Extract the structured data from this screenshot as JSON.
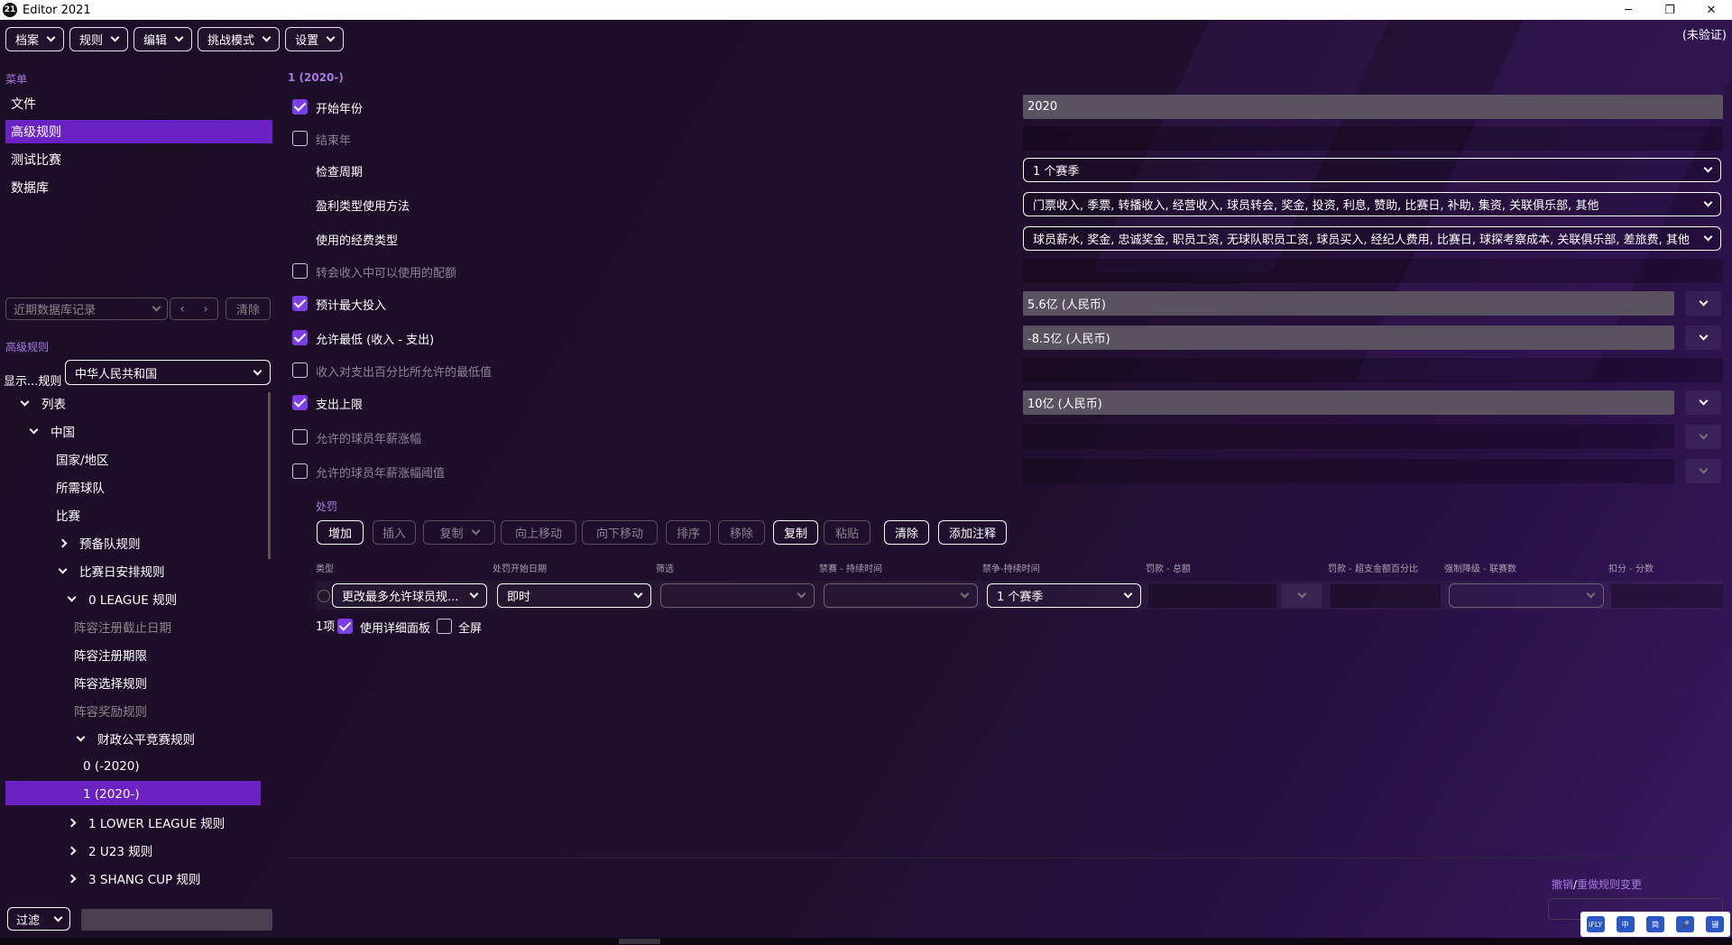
{
  "window": {
    "title": "Editor 2021",
    "app_icon": "21",
    "minimize": "─",
    "restore": "❐",
    "close": "✕"
  },
  "menubar": {
    "items": [
      "档案",
      "规则",
      "编辑",
      "挑战模式",
      "设置"
    ],
    "status": "(未验证)"
  },
  "sidebar": {
    "menu_label": "菜单",
    "items": [
      "文件",
      "高级规则",
      "测试比赛",
      "数据库"
    ],
    "active_index": 1,
    "recent_placeholder": "近期数据库记录",
    "nav_prev": "‹",
    "nav_next": "›",
    "clear_label": "清除",
    "advanced_label": "高级规则",
    "show_rules_label": "显示...规则",
    "nation_select": "中华人民共和国",
    "tree": [
      {
        "label": "列表",
        "depth": 0,
        "toggle": "expanded"
      },
      {
        "label": "中国",
        "depth": 1,
        "toggle": "expanded"
      },
      {
        "label": "国家/地区",
        "depth": 2,
        "toggle": "none"
      },
      {
        "label": "所需球队",
        "depth": 2,
        "toggle": "none"
      },
      {
        "label": "比赛",
        "depth": 2,
        "toggle": "none"
      },
      {
        "label": "预备队规则",
        "depth": 2,
        "toggle": "collapsed"
      },
      {
        "label": "比赛日安排规则",
        "depth": 2,
        "toggle": "expanded"
      },
      {
        "label": "0 LEAGUE 规则",
        "depth": 3,
        "toggle": "expanded"
      },
      {
        "label": "阵容注册截止日期",
        "depth": 4,
        "toggle": "none",
        "dim": true
      },
      {
        "label": "阵容注册期限",
        "depth": 4,
        "toggle": "none"
      },
      {
        "label": "阵容选择规则",
        "depth": 4,
        "toggle": "none"
      },
      {
        "label": "阵容奖励规则",
        "depth": 4,
        "toggle": "none",
        "dim": true
      },
      {
        "label": "财政公平竞赛规则",
        "depth": 4,
        "toggle": "expanded"
      },
      {
        "label": "0 (-2020)",
        "depth": 5,
        "toggle": "none"
      },
      {
        "label": "1 (2020-)",
        "depth": 5,
        "toggle": "none",
        "selected": true
      },
      {
        "label": "1 LOWER LEAGUE 规则",
        "depth": 3,
        "toggle": "collapsed"
      },
      {
        "label": "2 U23 规则",
        "depth": 3,
        "toggle": "collapsed"
      },
      {
        "label": "3 SHANG CUP 规则",
        "depth": 3,
        "toggle": "collapsed"
      }
    ],
    "filter_label": "过滤"
  },
  "content": {
    "title": "1 (2020-)",
    "rows": [
      {
        "label": "开始年份",
        "checkbox": true,
        "checked": true,
        "value": "2020"
      },
      {
        "label": "结束年",
        "checkbox": true,
        "checked": false,
        "value": ""
      },
      {
        "label": "检查周期",
        "checkbox": false,
        "value": "1 个赛季"
      },
      {
        "label": "盈利类型使用方法",
        "checkbox": false,
        "value": "门票收入, 季票, 转播收入, 经营收入, 球员转会, 奖金, 投资, 利息, 赞助, 比赛日, 补助, 集资, 关联俱乐部, 其他"
      },
      {
        "label": "使用的经费类型",
        "checkbox": false,
        "value": "球员薪水, 奖金, 忠诚奖金, 职员工资, 无球队职员工资, 球员买入, 经纪人费用, 比赛日, 球探考察成本, 关联俱乐部, 差旅费, 其他"
      },
      {
        "label": "转会收入中可以使用的配额",
        "checkbox": true,
        "checked": false,
        "value": ""
      },
      {
        "label": "预计最大投入",
        "checkbox": true,
        "checked": true,
        "value": "5.6亿 (人民币)"
      },
      {
        "label": "允许最低 (收入 - 支出)",
        "checkbox": true,
        "checked": true,
        "value": "-8.5亿 (人民币)"
      },
      {
        "label": "收入对支出百分比所允许的最低值",
        "checkbox": true,
        "checked": false,
        "value": ""
      },
      {
        "label": "支出上限",
        "checkbox": true,
        "checked": true,
        "value": "10亿 (人民币)"
      },
      {
        "label": "允许的球员年薪涨幅",
        "checkbox": true,
        "checked": false,
        "value": ""
      },
      {
        "label": "允许的球员年薪涨幅阈值",
        "checkbox": true,
        "checked": false,
        "value": ""
      }
    ],
    "penalty": {
      "label": "处罚",
      "toolbar": [
        "增加",
        "插入",
        "复制",
        "向上移动",
        "向下移动",
        "排序",
        "移除",
        "复制",
        "粘贴",
        "清除",
        "添加注释"
      ],
      "columns": [
        "类型",
        "处罚开始日期",
        "筛选",
        "禁赛 - 持续时间",
        "禁争-持续时间",
        "罚款 - 总额",
        "罚款 - 超支金额百分比",
        "强制降级 - 联赛数",
        "扣分 - 分数"
      ],
      "row": {
        "type": "更改最多允许球员规...",
        "start": "即时",
        "filter": "",
        "ban_duration": "",
        "contest_ban": "1 个赛季",
        "demotion": ""
      },
      "count": "1项",
      "detail_panel_label": "使用详细面板",
      "fullscreen_label": "全屏"
    },
    "undo_label": "撤销",
    "undo_suffix": "重做规则变更"
  },
  "tray": {
    "icons": [
      "iFLY",
      "中",
      "简",
      "🎤",
      "键"
    ]
  },
  "colors": {
    "accent": "#6a22c4",
    "label_purple": "#a77ae0",
    "checkbox": "#7b3fe4"
  }
}
